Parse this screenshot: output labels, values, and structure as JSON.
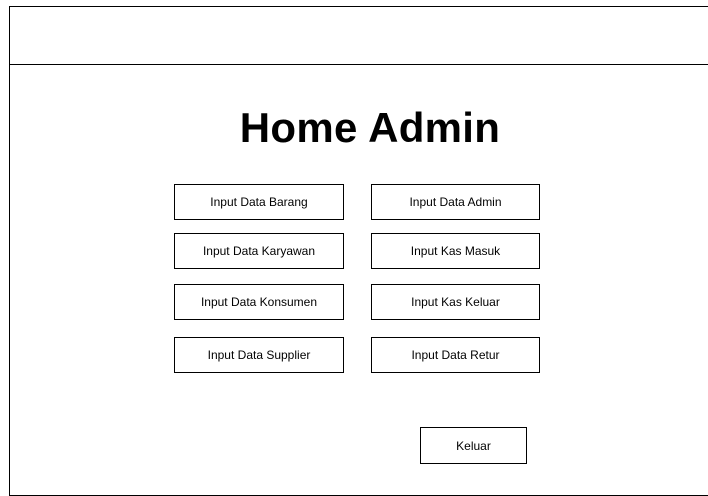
{
  "page": {
    "title": "Home Admin"
  },
  "menu": {
    "left": [
      "Input Data Barang",
      "Input Data Karyawan",
      "Input Data Konsumen",
      "Input Data Supplier"
    ],
    "right": [
      "Input Data Admin",
      "Input Kas Masuk",
      "Input Kas Keluar",
      "Input Data Retur"
    ]
  },
  "footer": {
    "logout_label": "Keluar"
  }
}
